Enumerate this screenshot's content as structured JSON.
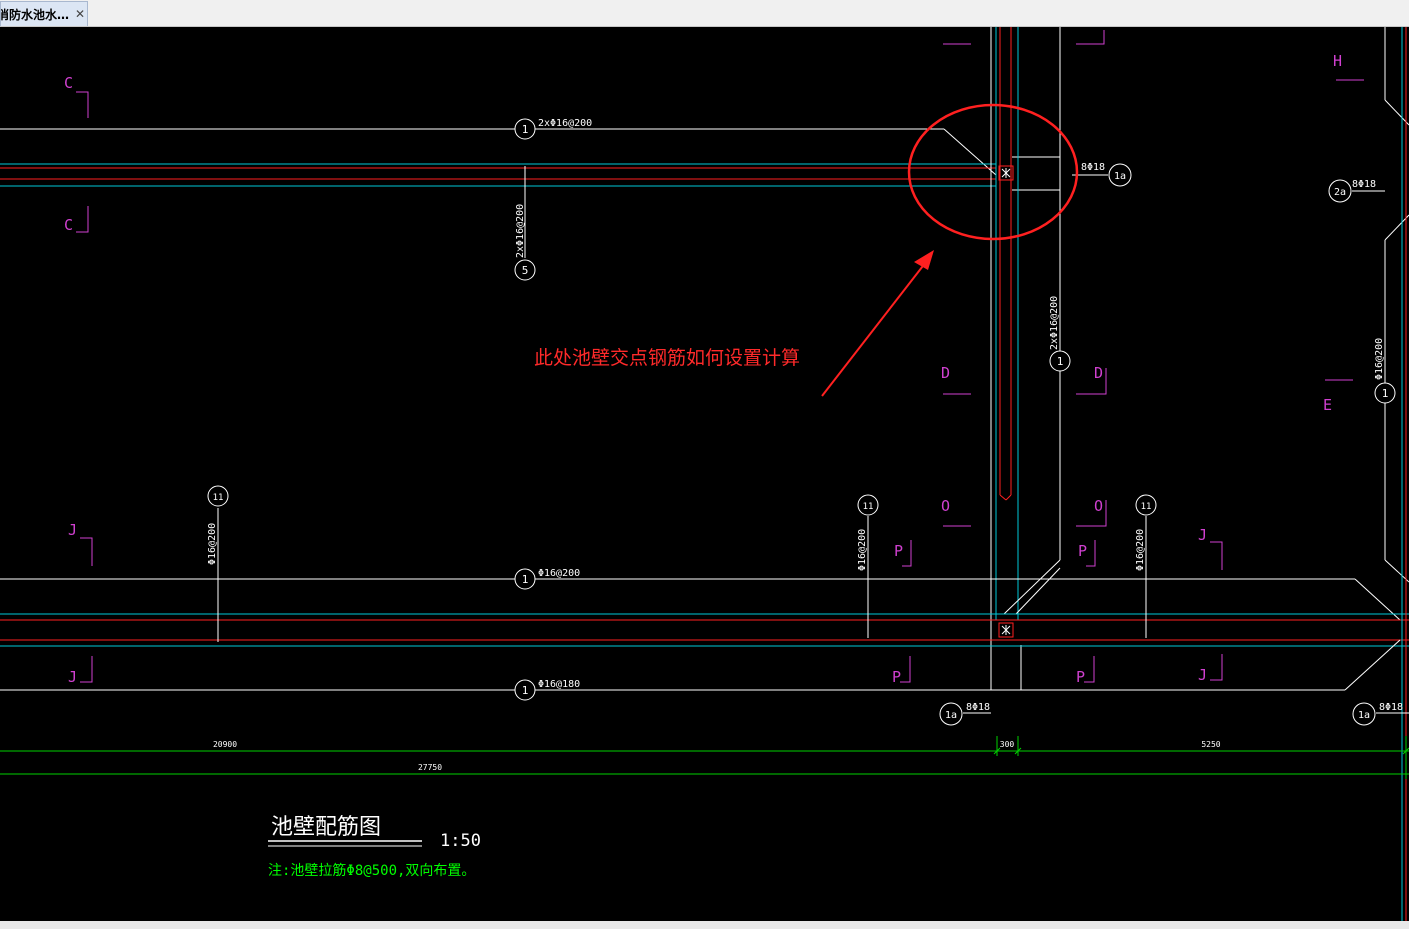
{
  "tab": {
    "title": "消防水池水…",
    "close_glyph": "✕"
  },
  "drawing": {
    "colors": {
      "background": "#000000",
      "rebar": "#ffffff",
      "wall_edge": "#00c8d8",
      "axis": "#ff2020",
      "section_mark": "#d040d0",
      "dimension": "#00d000",
      "annotation": "#ff2a2a"
    },
    "rebar_callouts": [
      {
        "num": "1",
        "text": "2xΦ16@200"
      },
      {
        "num": "5",
        "text": "2xΦ16@200"
      },
      {
        "num": "1",
        "text": "2xΦ16@200"
      },
      {
        "num": "1",
        "text": "Φ16@200"
      },
      {
        "num": "1",
        "text": "Φ16@180"
      },
      {
        "num": "1",
        "text": "Φ16@200"
      },
      {
        "num": "11",
        "text": "Φ16@200"
      },
      {
        "num": "11",
        "text": "Φ16@200"
      },
      {
        "num": "11",
        "text": "Φ16@200"
      }
    ],
    "corner_callouts": [
      {
        "num": "1a",
        "text": "8Φ18"
      },
      {
        "num": "2a",
        "text": "8Φ18"
      },
      {
        "num": "1a",
        "text": "8Φ18"
      },
      {
        "num": "1a",
        "text": "8Φ18"
      }
    ],
    "section_letters": [
      "C",
      "C",
      "D",
      "D",
      "O",
      "O",
      "P",
      "P",
      "P",
      "P",
      "J",
      "J",
      "J",
      "J",
      "H",
      "E"
    ],
    "dimensions": [
      "20900",
      "300",
      "5250",
      "27750"
    ],
    "annotation": "此处池壁交点钢筋如何设置计算",
    "title": "池壁配筋图",
    "scale": "1:50",
    "note": "注:池壁拉筋Φ8@500,双向布置。"
  }
}
